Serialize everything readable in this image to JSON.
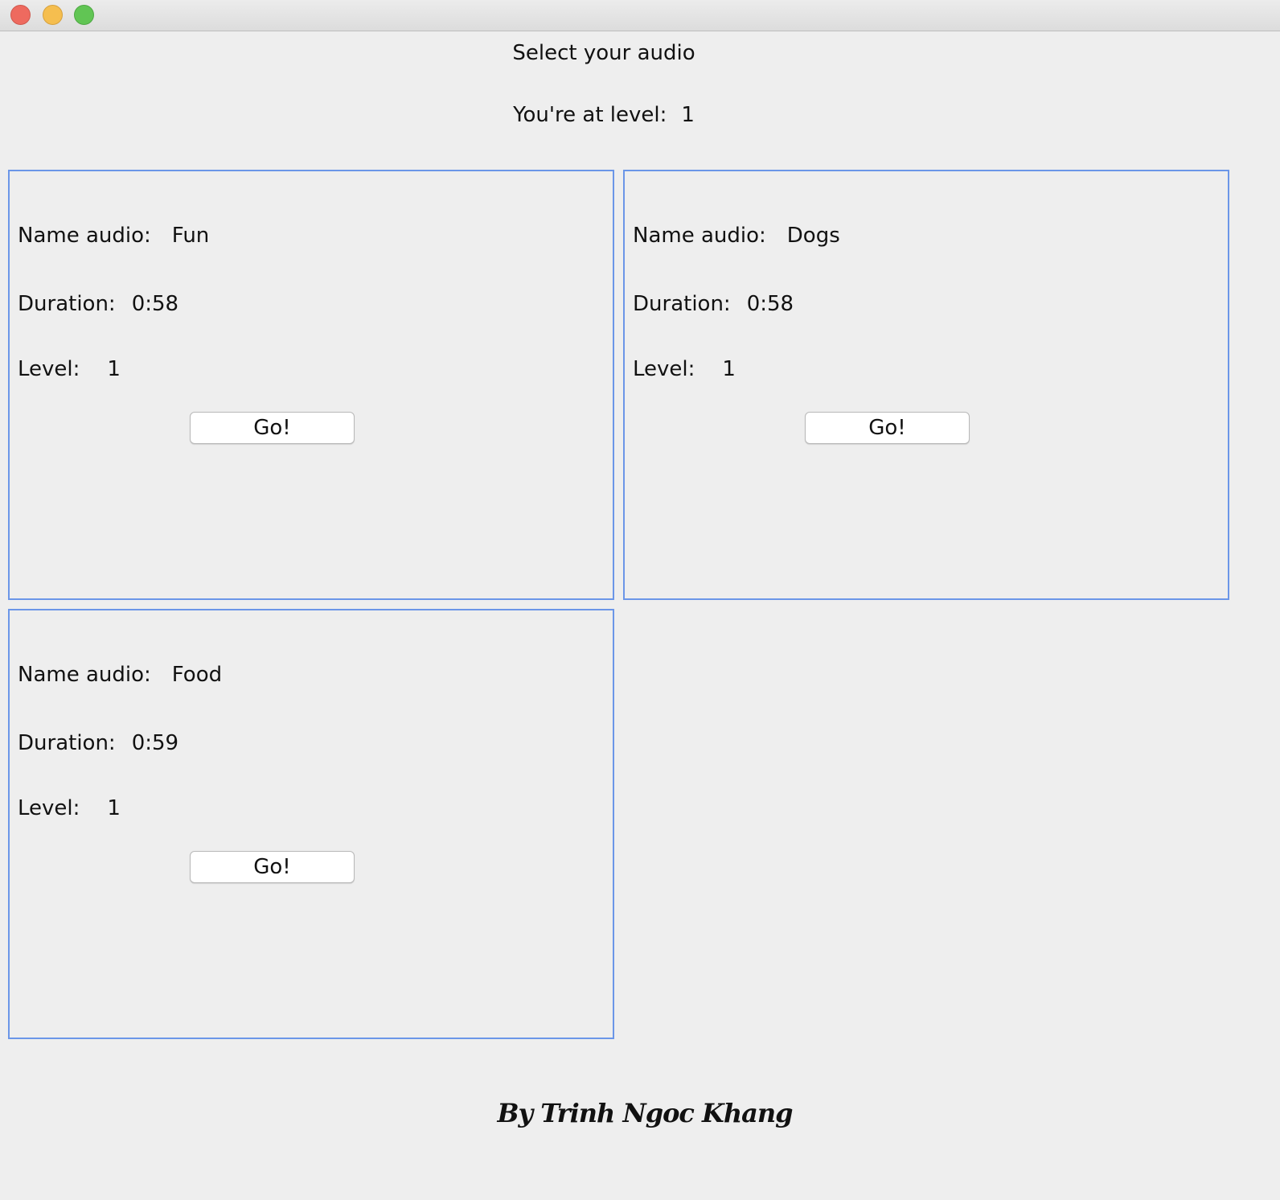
{
  "window": {
    "controls": [
      "close",
      "minimize",
      "maximize"
    ]
  },
  "header": {
    "title": "Select your audio",
    "level_label": "You're at level:",
    "level_value": "1"
  },
  "labels": {
    "name": "Name audio:",
    "duration": "Duration:",
    "level": "Level:",
    "go": "Go!"
  },
  "audios": [
    {
      "name": "Fun",
      "duration": "0:58",
      "level": "1"
    },
    {
      "name": "Dogs",
      "duration": "0:58",
      "level": "1"
    },
    {
      "name": "Food",
      "duration": "0:59",
      "level": "1"
    }
  ],
  "footer": {
    "credit": "By Trinh Ngoc Khang"
  },
  "colors": {
    "card_border": "#6b96e8",
    "background": "#eeeeee"
  }
}
